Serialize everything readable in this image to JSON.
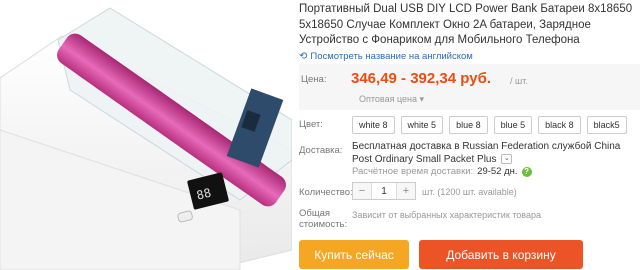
{
  "product": {
    "title": "Портативный Dual USB DIY LCD Power Bank Батареи 8x18650 5x18650 Случае Комплект Окно 2A батареи, Зарядное Устройство с Фонариком для Мобильного Телефона",
    "translate_link": "Посмотреть название на английском"
  },
  "price": {
    "label": "Цена:",
    "value": "346,49 - 392,34 руб.",
    "unit": "/ шт.",
    "wholesale": "Оптовая цена ▾"
  },
  "color": {
    "label": "Цвет:",
    "options": [
      "white 8",
      "white 5",
      "blue 8",
      "blue 5",
      "black 8",
      "black5"
    ]
  },
  "delivery": {
    "label": "Доставка:",
    "text": "Бесплатная доставка в Russian Federation службой China Post Ordinary Small Packet Plus",
    "select_glyph": "⌄",
    "eta_label": "Расчётное время доставки:",
    "eta_days": "29-52 дн.",
    "help_glyph": "?"
  },
  "quantity": {
    "label": "Количество:",
    "minus": "−",
    "value": "1",
    "plus": "+",
    "available": "шт. (1200 шт. available)"
  },
  "total": {
    "label_line1": "Общая",
    "label_line2": "стоимость:",
    "note": "Зависит от выбранных характеристик товара"
  },
  "buttons": {
    "buy_now": "Купить сейчас",
    "add_to_cart": "Добавить в корзину"
  },
  "colors": {
    "accent_price": "#ee4c0f",
    "buy_now_bg": "#f5a623",
    "add_cart_bg": "#ec5428",
    "link": "#2a6bbf",
    "cell_pink": "#d94aa2"
  }
}
